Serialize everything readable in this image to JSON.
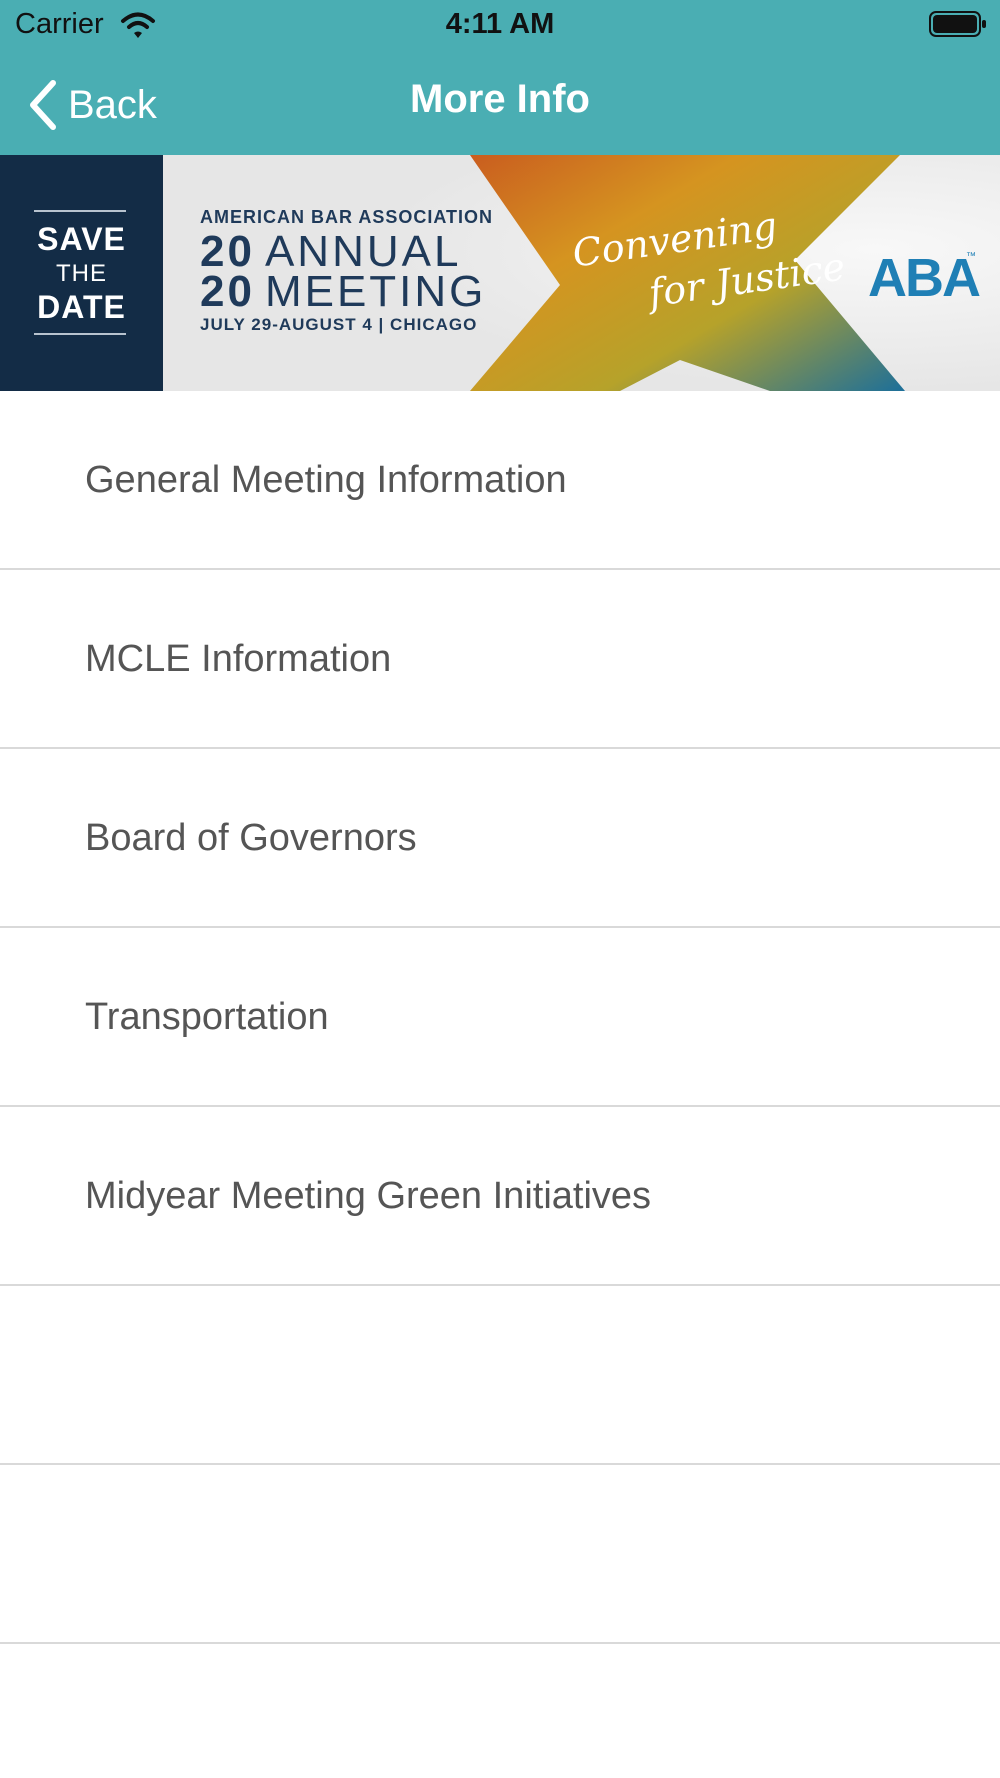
{
  "status_bar": {
    "carrier": "Carrier",
    "time": "4:11 AM",
    "icons": [
      "wifi-icon",
      "battery-icon"
    ]
  },
  "nav": {
    "back_label": "Back",
    "title": "More Info",
    "back_icon": "chevron-left-icon"
  },
  "banner": {
    "save_line1": "SAVE",
    "save_line2": "THE",
    "save_line3": "DATE",
    "association": "AMERICAN BAR ASSOCIATION",
    "year_top": "20",
    "word_top": "ANNUAL",
    "year_bottom": "20",
    "word_bottom": "MEETING",
    "dates": "JULY 29-AUGUST 4 | CHICAGO",
    "script_line1": "Convening",
    "script_line2": "for Justice",
    "logo": "ABA",
    "logo_mark": "™"
  },
  "list": {
    "items": [
      {
        "label": "General Meeting Information"
      },
      {
        "label": "MCLE Information"
      },
      {
        "label": "Board of Governors"
      },
      {
        "label": "Transportation"
      },
      {
        "label": "Midyear Meeting Green Initiatives"
      }
    ]
  },
  "colors": {
    "nav_bar": "#4aaeb3",
    "list_text": "#555555",
    "separator": "#d9d9d9",
    "banner_navy": "#132c46",
    "aba_blue": "#1f7fb5"
  }
}
